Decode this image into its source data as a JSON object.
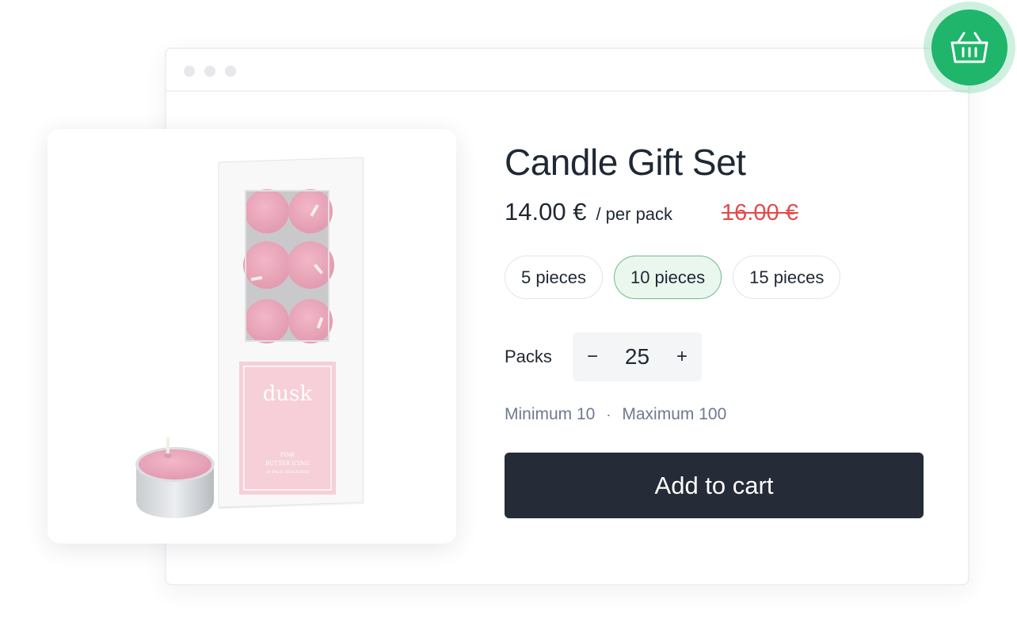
{
  "product": {
    "title": "Candle Gift Set",
    "price": "14.00 €",
    "price_unit": "/ per pack",
    "old_price": "16.00 €"
  },
  "options": [
    {
      "label": "5 pieces",
      "selected": false
    },
    {
      "label": "10 pieces",
      "selected": true
    },
    {
      "label": "15 pieces",
      "selected": false
    }
  ],
  "quantity": {
    "label": "Packs",
    "decrement": "−",
    "value": "25",
    "increment": "+"
  },
  "limits": {
    "min": "Minimum 10",
    "separator": "·",
    "max": "Maximum 100"
  },
  "cart": {
    "button_label": "Add to cart",
    "icon": "basket-icon"
  },
  "image": {
    "brand": "dusk",
    "label_line1": "PINK",
    "label_line2": "BUTTER ICING",
    "label_line3": "10 PACK TEALIGHTS"
  },
  "colors": {
    "accent_green": "#1fb56b",
    "old_price_red": "#e34b4b",
    "button_dark": "#252c37",
    "selected_pill_bg": "#e9f7ee"
  }
}
